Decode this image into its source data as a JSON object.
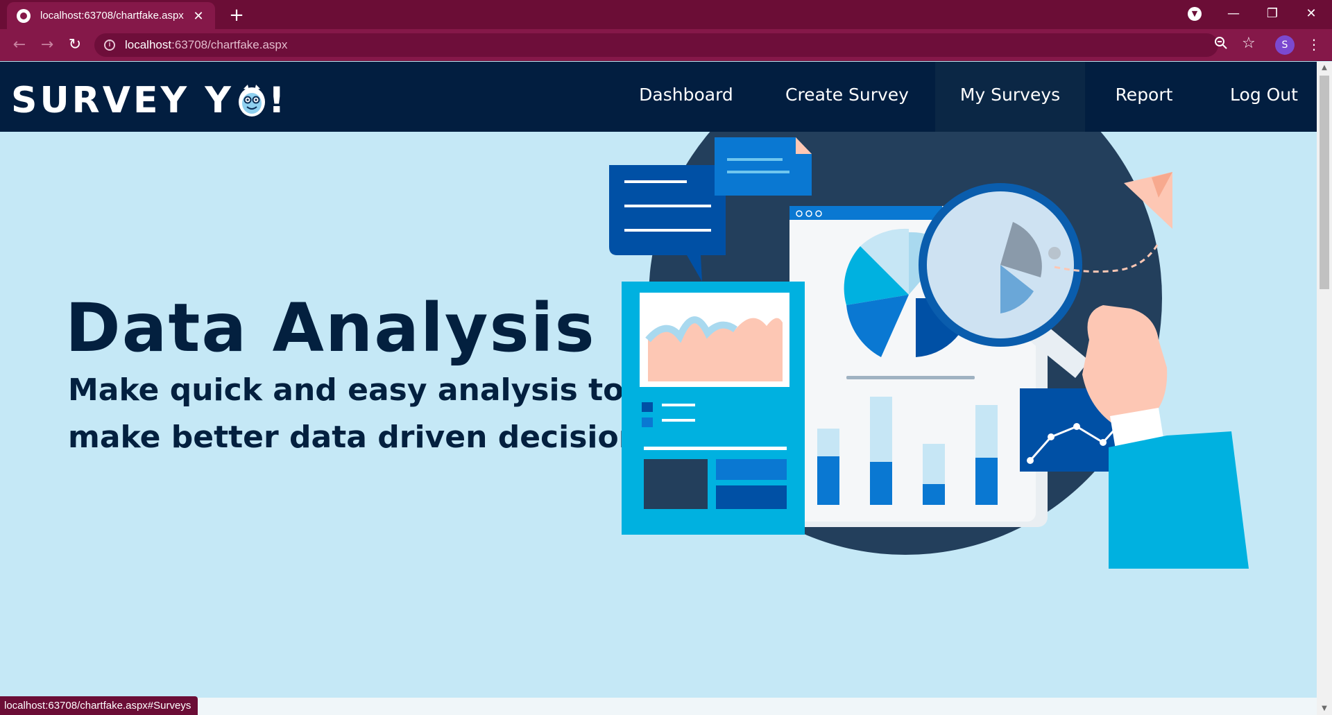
{
  "browser": {
    "tab_title": "localhost:63708/chartfake.aspx",
    "tab_close": "✕",
    "new_tab": "+",
    "url_host": "localhost",
    "url_path": ":63708/chartfake.aspx",
    "avatar_letter": "S",
    "status_url": "localhost:63708/chartfake.aspx#Surveys",
    "icons": {
      "back": "arrow-left-icon",
      "forward": "arrow-right-icon",
      "reload": "reload-icon",
      "info": "info-icon",
      "zoom": "zoom-icon",
      "bookmark": "star-icon",
      "menu": "kebab-menu-icon"
    }
  },
  "site": {
    "logo_text_left": "SURVEY Y",
    "logo_text_right": "!",
    "nav": [
      {
        "label": "Dashboard"
      },
      {
        "label": "Create Survey"
      },
      {
        "label": "My Surveys"
      },
      {
        "label": "Report"
      },
      {
        "label": "Log Out"
      }
    ],
    "active_nav": "My Surveys"
  },
  "hero": {
    "title": "Data Analysis",
    "subtitle_line1": "Make quick and easy analysis to",
    "subtitle_line2": "make better data driven decision"
  },
  "colors": {
    "browser_frame": "#6b0d36",
    "browser_toolbar": "#851849",
    "nav_bg": "#021e40",
    "hero_bg": "#c5e8f6",
    "text_dark": "#03203f"
  }
}
